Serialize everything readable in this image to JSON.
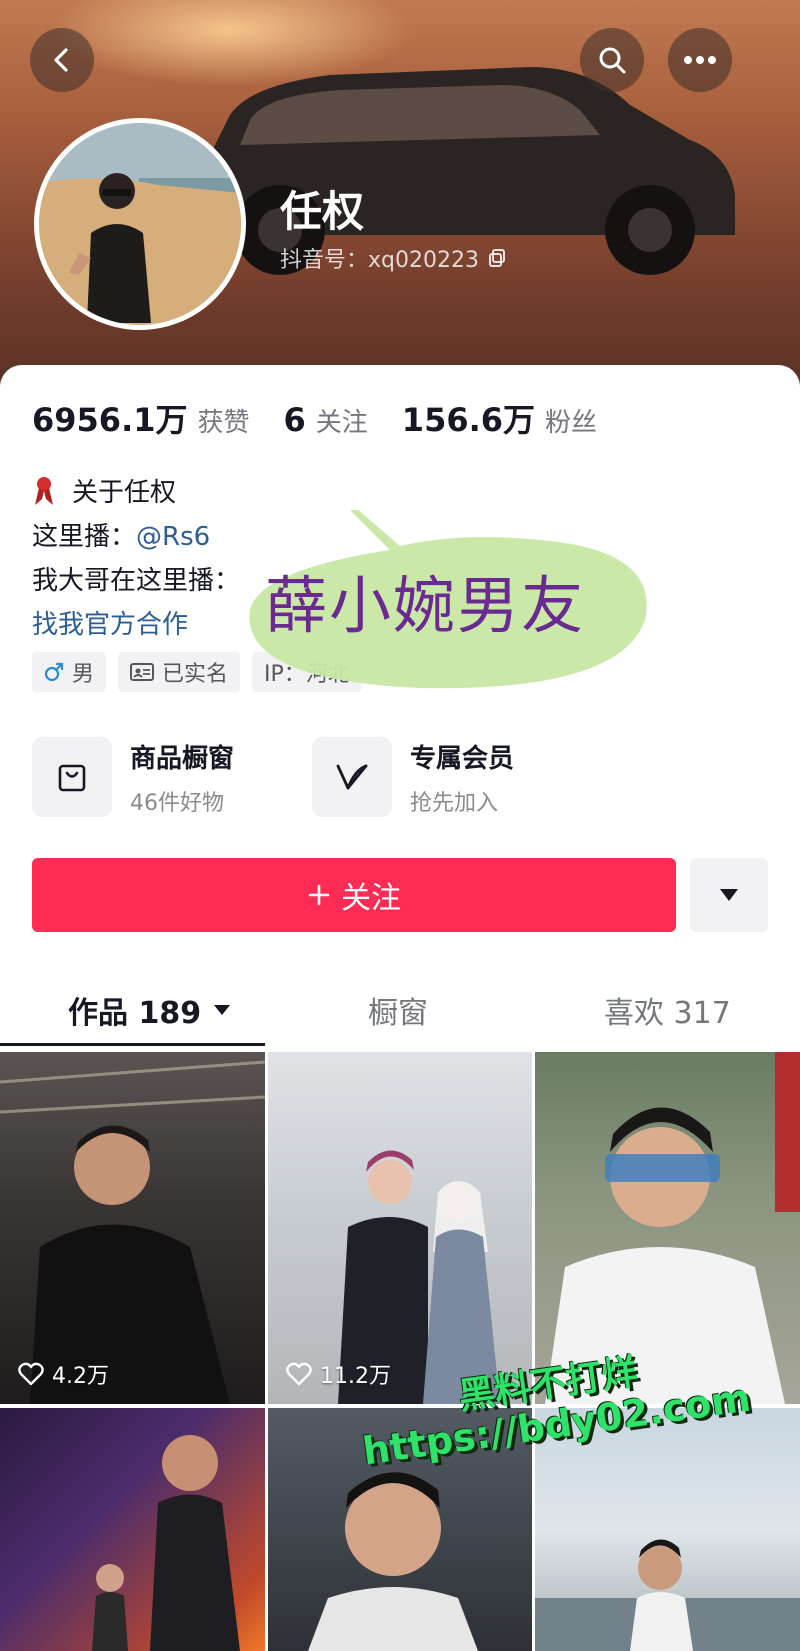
{
  "header": {
    "back_icon": "chevron-left-icon",
    "search_icon": "search-icon",
    "more_icon": "more-dots-icon"
  },
  "profile": {
    "name": "任权",
    "douyin_id": "抖音号：xq020223",
    "copy_icon": "copy-icon"
  },
  "stats": [
    {
      "value": "6956.1万",
      "label": "获赞"
    },
    {
      "value": "6",
      "label": "关注"
    },
    {
      "value": "156.6万",
      "label": "粉丝"
    }
  ],
  "bio": {
    "about": "关于任权",
    "line1_prefix": "这里播：",
    "line1_link": "@Rs6",
    "line2": "我大哥在这里播：",
    "business_link": "找我官方合作"
  },
  "tags": {
    "gender": "男",
    "verified": "已实名",
    "ip": "IP：河北"
  },
  "features": [
    {
      "title": "商品橱窗",
      "subtitle": "46件好物",
      "icon": "shopping-bag-icon"
    },
    {
      "title": "专属会员",
      "subtitle": "抢先加入",
      "icon": "v-member-icon"
    }
  ],
  "actions": {
    "follow_label": "关注",
    "dropdown_icon": "triangle-down-icon"
  },
  "tabs": [
    {
      "label": "作品 189"
    },
    {
      "label": "橱窗"
    },
    {
      "label": "喜欢 317"
    }
  ],
  "videos": [
    {
      "likes": "4.2万"
    },
    {
      "likes": "11.2万"
    }
  ],
  "overlay": {
    "bubble_text": "薛小婉男友",
    "watermark_line1": "黑料不打烊",
    "watermark_line2": "https://bdy02.com"
  },
  "colors": {
    "accent": "#fe2c55",
    "link": "#2c5d96",
    "watermark": "#2fe26a"
  }
}
